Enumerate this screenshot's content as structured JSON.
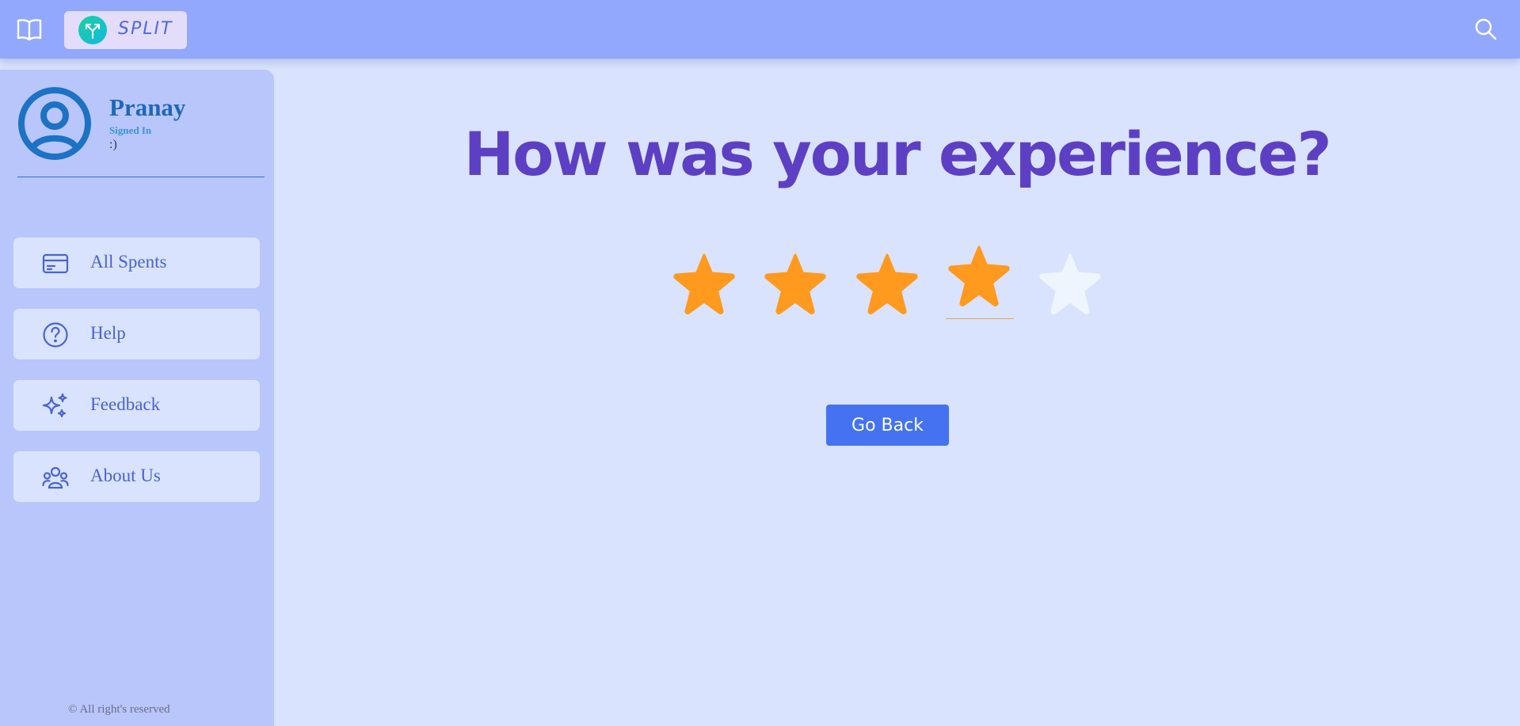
{
  "header": {
    "brand_name": "SPLIT",
    "icons": [
      "book-icon",
      "split-logo-icon",
      "search-icon"
    ]
  },
  "sidebar": {
    "user": {
      "name": "Pranay",
      "status": "Signed In",
      "emoticon": ":)"
    },
    "items": [
      {
        "label": "All Spents",
        "icon": "credit-card-icon"
      },
      {
        "label": "Help",
        "icon": "question-circle-icon"
      },
      {
        "label": "Feedback",
        "icon": "sparkles-icon"
      },
      {
        "label": "About Us",
        "icon": "people-icon"
      }
    ],
    "footer": "© All right's reserved"
  },
  "main": {
    "heading": "How was your experience?",
    "rating": {
      "value": 4,
      "max": 5
    },
    "go_back_label": "Go Back"
  },
  "colors": {
    "topbar": "#92a8fd",
    "sidebar": "#b9c6fc",
    "background": "#d9e3fd",
    "heading": "#5d3fc3",
    "star_filled": "#ff9a1f",
    "star_empty": "#eef5fd",
    "button": "#4472f0"
  }
}
